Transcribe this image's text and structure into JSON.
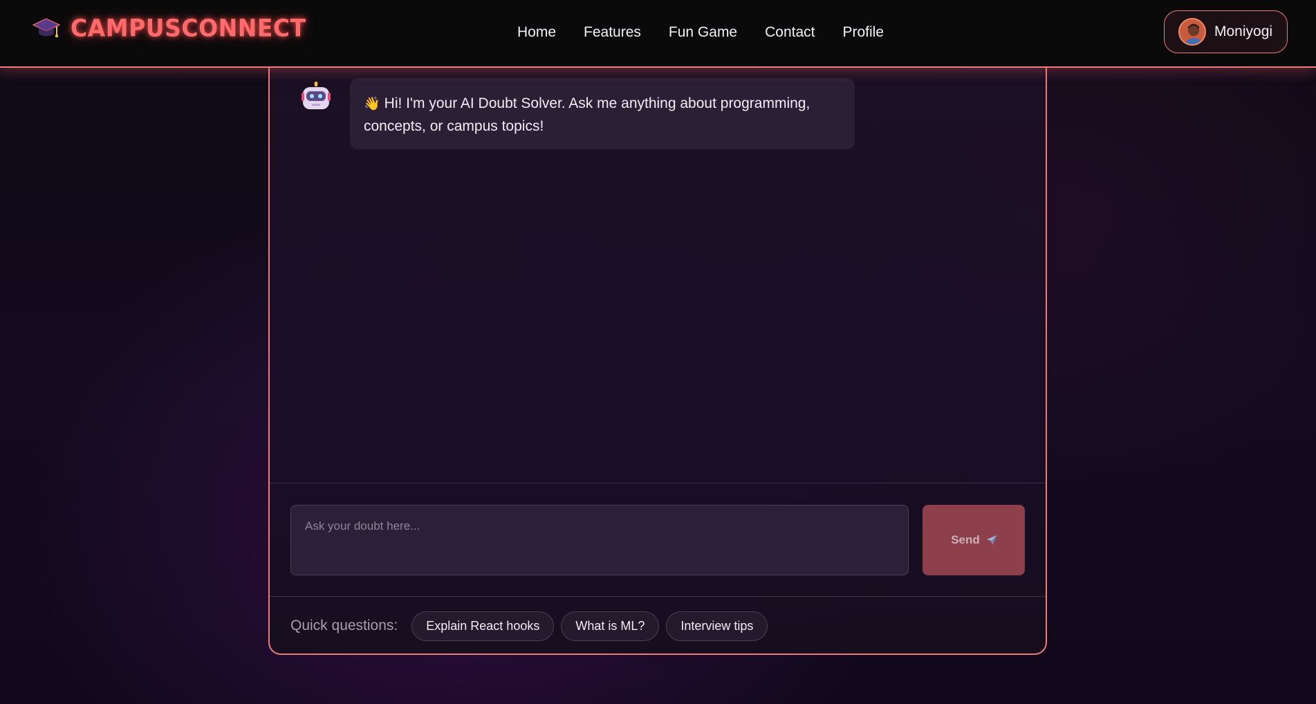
{
  "navbar": {
    "brand": "CAMPUSCONNECT",
    "brand_icon": "graduation-cap-icon",
    "links": [
      "Home",
      "Features",
      "Fun Game",
      "Contact",
      "Profile"
    ],
    "user": {
      "name": "Moniyogi",
      "avatar_icon": "user-avatar"
    }
  },
  "chat": {
    "bot_icon": "robot-icon",
    "messages": [
      {
        "sender": "bot",
        "emoji": "👋",
        "text": "Hi! I'm your AI Doubt Solver. Ask me anything about programming, concepts, or campus topics!"
      }
    ],
    "input": {
      "placeholder": "Ask your doubt here...",
      "value": ""
    },
    "send": {
      "label": "Send",
      "icon": "paper-plane-icon"
    },
    "quick_questions": {
      "label": "Quick questions:",
      "items": [
        "Explain React hooks",
        "What is ML?",
        "Interview tips"
      ]
    }
  },
  "colors": {
    "accent": "#f07b7b",
    "brand_text": "#ff6b6b",
    "send_button": "#8e3f4c",
    "bubble": "#2b1f36"
  }
}
